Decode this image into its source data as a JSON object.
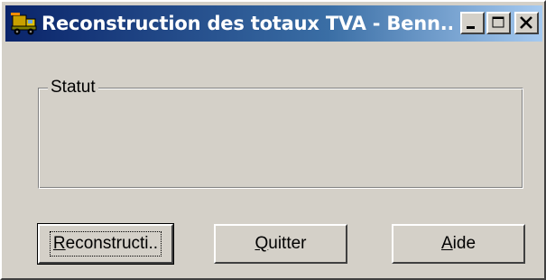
{
  "window": {
    "title": "Reconstruction des totaux TVA - Benn...",
    "app_icon": "truck-icon",
    "controls": {
      "minimize_icon": "minimize-icon",
      "maximize_icon": "maximize-icon",
      "close_icon": "close-icon"
    }
  },
  "status_group": {
    "label": "Statut",
    "content": ""
  },
  "buttons": {
    "reconstruct": {
      "mnemonic": "R",
      "rest": "econstructi.."
    },
    "quit": {
      "mnemonic": "Q",
      "rest": "uitter"
    },
    "help": {
      "mnemonic": "A",
      "rest": "ide"
    }
  },
  "colors": {
    "face": "#d4d0c8",
    "title_start": "#0a246a",
    "title_end": "#a6caf0",
    "title_text": "#ffffff"
  }
}
